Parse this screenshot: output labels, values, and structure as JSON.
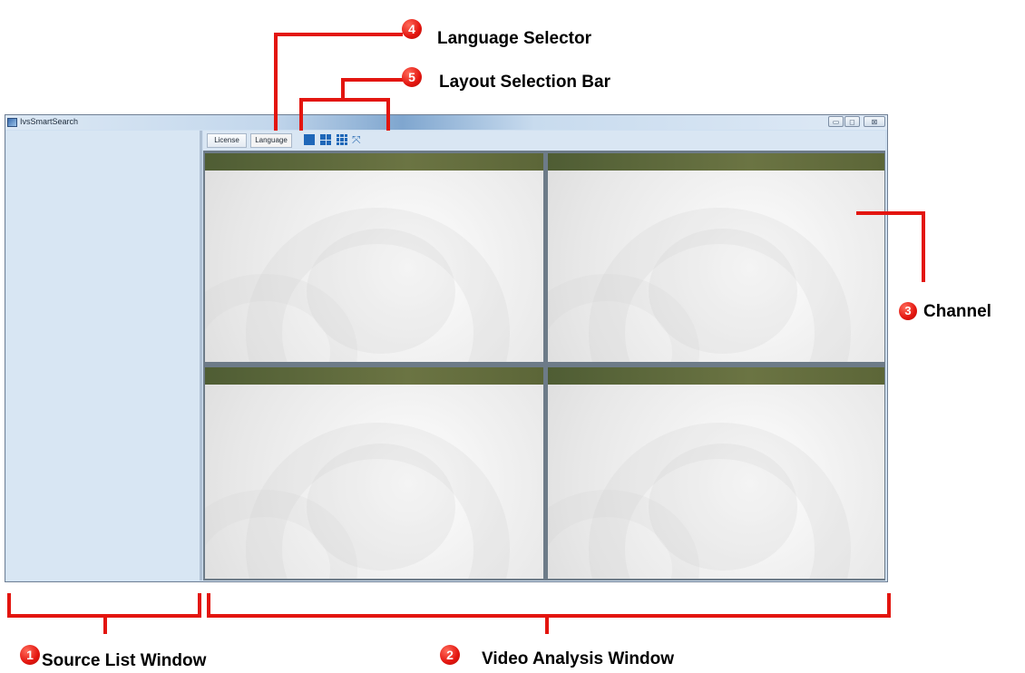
{
  "window": {
    "title": "IvsSmartSearch",
    "controls": {
      "minimize": "▭",
      "maximize": "◻",
      "close": "⊠"
    }
  },
  "toolbar": {
    "license_label": "License",
    "language_label": "Language",
    "layout_options": [
      "layout-1x1-icon",
      "layout-2x2-icon",
      "layout-3x3-icon",
      "fullscreen-icon"
    ],
    "fullscreen_glyph": "⤧"
  },
  "channels": [
    {
      "id": 1
    },
    {
      "id": 2
    },
    {
      "id": 3
    },
    {
      "id": 4
    }
  ],
  "annotations": [
    {
      "number": "1",
      "label": "Source List Window"
    },
    {
      "number": "2",
      "label": "Video Analysis Window"
    },
    {
      "number": "3",
      "label": "Channel"
    },
    {
      "number": "4",
      "label": "Language Selector"
    },
    {
      "number": "5",
      "label": "Layout Selection Bar"
    }
  ],
  "colors": {
    "annotation_red": "#e3150f",
    "layout_icon_blue": "#1f67b8",
    "source_list_bg": "#d8e6f3",
    "channel_header": "#5c6638"
  }
}
